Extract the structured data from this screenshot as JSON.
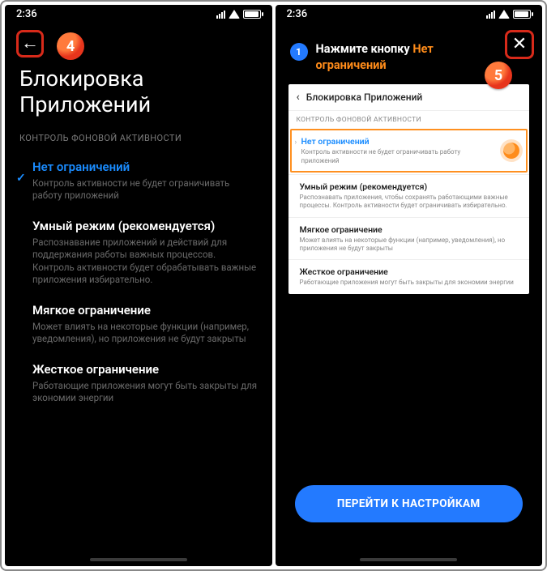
{
  "status": {
    "time": "2:36"
  },
  "left": {
    "title_line1": "Блокировка",
    "title_line2": "Приложений",
    "subheader": "КОНТРОЛЬ ФОНОВОЙ АКТИВНОСТИ",
    "options": [
      {
        "h": "Нет ограничений",
        "d": "Контроль активности не будет ограничивать работу приложений"
      },
      {
        "h": "Умный режим (рекомендуется)",
        "d": "Распознавание приложений и действий для поддержания работы важных процессов. Контроль активности будет обрабатывать важные приложения избирательно."
      },
      {
        "h": "Мягкое ограничение",
        "d": "Может влиять на некоторые функции (например, уведомления), но приложения не будут закрыты"
      },
      {
        "h": "Жесткое ограничение",
        "d": "Работающие приложения могут быть закрыты для экономии энергии"
      }
    ]
  },
  "right": {
    "step": "1",
    "instr_prefix": "Нажмите кнопку ",
    "instr_highlight": "Нет ограничений",
    "card": {
      "title": "Блокировка Приложений",
      "sub": "КОНТРОЛЬ ФОНОВОЙ АКТИВНОСТИ",
      "options": [
        {
          "h": "Нет ограничений",
          "d": "Контроль активности не будет ограничивать работу приложений"
        },
        {
          "h": "Умный режим (рекомендуется)",
          "d": "Распознавать приложения, чтобы сохранять работающими важные процессы. Контроль активности будет ограничивать избирательно."
        },
        {
          "h": "Мягкое ограничение",
          "d": "Может влиять на некоторые функции (например, уведомления), но приложения не будут закрыты"
        },
        {
          "h": "Жесткое ограничение",
          "d": "Работающие приложения могут быть закрыты для экономии энергии"
        }
      ]
    },
    "cta": "ПЕРЕЙТИ К НАСТРОЙКАМ"
  },
  "badges": {
    "b4": "4",
    "b5": "5"
  }
}
